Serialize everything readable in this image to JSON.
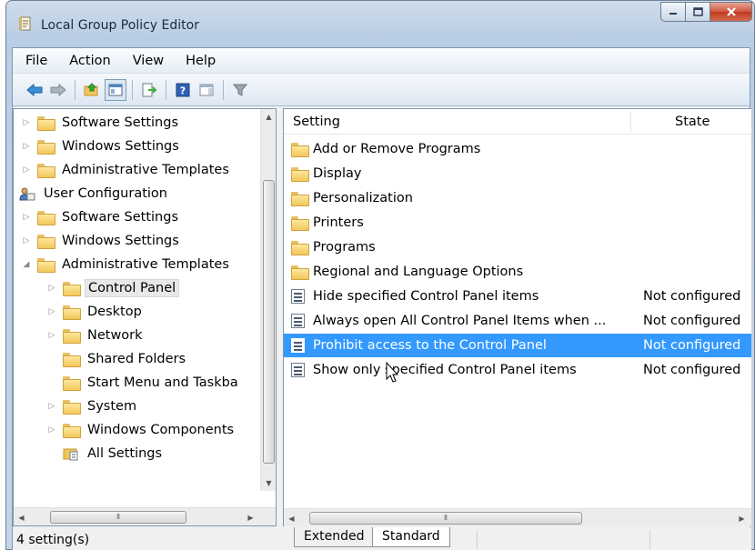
{
  "window": {
    "title": "Local Group Policy Editor"
  },
  "menu": [
    "File",
    "Action",
    "View",
    "Help"
  ],
  "toolbar_icons": [
    "back-arrow-icon",
    "forward-arrow-icon",
    "up-folder-icon",
    "show-hide-tree-icon",
    "export-list-icon",
    "help-icon",
    "show-hide-action-pane-icon",
    "filter-icon"
  ],
  "tree": {
    "items": [
      {
        "label": "Software Settings",
        "expander": "collapsed",
        "indent": 0
      },
      {
        "label": "Windows Settings",
        "expander": "collapsed",
        "indent": 0
      },
      {
        "label": "Administrative Templates",
        "expander": "collapsed",
        "indent": 0
      },
      {
        "label": "User Configuration",
        "expander": "none",
        "indent": -1
      },
      {
        "label": "Software Settings",
        "expander": "collapsed",
        "indent": 0
      },
      {
        "label": "Windows Settings",
        "expander": "collapsed",
        "indent": 0
      },
      {
        "label": "Administrative Templates",
        "expander": "expanded",
        "indent": 0
      },
      {
        "label": "Control Panel",
        "expander": "collapsed",
        "indent": 1,
        "selected": true
      },
      {
        "label": "Desktop",
        "expander": "collapsed",
        "indent": 1
      },
      {
        "label": "Network",
        "expander": "collapsed",
        "indent": 1
      },
      {
        "label": "Shared Folders",
        "expander": "none",
        "indent": 1
      },
      {
        "label": "Start Menu and Taskba",
        "expander": "none",
        "indent": 1
      },
      {
        "label": "System",
        "expander": "collapsed",
        "indent": 1
      },
      {
        "label": "Windows Components",
        "expander": "collapsed",
        "indent": 1
      },
      {
        "label": "All Settings",
        "expander": "none",
        "indent": 1
      }
    ]
  },
  "list": {
    "columns": {
      "setting": "Setting",
      "state": "State"
    },
    "rows": [
      {
        "name": "Add or Remove Programs",
        "state": "",
        "type": "folder"
      },
      {
        "name": "Display",
        "state": "",
        "type": "folder"
      },
      {
        "name": "Personalization",
        "state": "",
        "type": "folder"
      },
      {
        "name": "Printers",
        "state": "",
        "type": "folder"
      },
      {
        "name": "Programs",
        "state": "",
        "type": "folder"
      },
      {
        "name": "Regional and Language Options",
        "state": "",
        "type": "folder"
      },
      {
        "name": "Hide specified Control Panel items",
        "state": "Not configured",
        "type": "policy"
      },
      {
        "name": "Always open All Control Panel Items when ...",
        "state": "Not configured",
        "type": "policy"
      },
      {
        "name": "Prohibit access to the Control Panel",
        "state": "Not configured",
        "type": "policy",
        "selected": true
      },
      {
        "name": "Show only specified Control Panel items",
        "state": "Not configured",
        "type": "policy"
      }
    ]
  },
  "tabs": [
    "Extended",
    "Standard"
  ],
  "active_tab": "Standard",
  "status": {
    "text": "4 setting(s)"
  },
  "colors": {
    "selection": "#3399ff",
    "folder": "#f1c75b"
  }
}
